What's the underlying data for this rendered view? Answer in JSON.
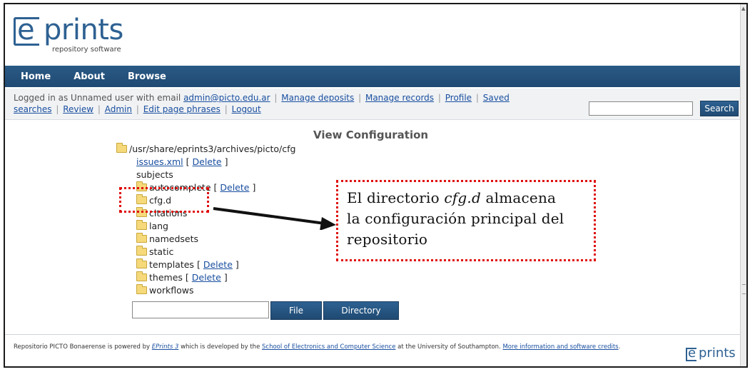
{
  "logo": {
    "e": "e",
    "prints": "prints",
    "subtitle": "repository software"
  },
  "nav": {
    "items": [
      "Home",
      "About",
      "Browse"
    ]
  },
  "login": {
    "prefix": "Logged in as Unnamed user with email ",
    "email": "admin@picto.edu.ar",
    "links_line1": [
      "Manage deposits",
      "Manage records",
      "Profile",
      "Saved"
    ],
    "links_line2": [
      "searches",
      "Review",
      "Admin",
      "Edit page phrases",
      "Logout"
    ],
    "separator": "|"
  },
  "search": {
    "button_label": "Search",
    "value": ""
  },
  "page": {
    "title": "View Configuration"
  },
  "tree": {
    "root": "/usr/share/eprints3/archives/picto/cfg",
    "delete_open": "[",
    "delete_label": "Delete",
    "delete_close": "]",
    "items": [
      {
        "name": "issues.xml",
        "type": "file-link",
        "deletable": true
      },
      {
        "name": "subjects",
        "type": "text",
        "deletable": false
      },
      {
        "name": "autocomplete",
        "type": "folder",
        "deletable": true
      },
      {
        "name": "cfg.d",
        "type": "folder",
        "deletable": false
      },
      {
        "name": "citations",
        "type": "folder",
        "deletable": false
      },
      {
        "name": "lang",
        "type": "folder",
        "deletable": false
      },
      {
        "name": "namedsets",
        "type": "folder",
        "deletable": false
      },
      {
        "name": "static",
        "type": "folder",
        "deletable": false
      },
      {
        "name": "templates",
        "type": "folder",
        "deletable": true
      },
      {
        "name": "themes",
        "type": "folder",
        "deletable": true
      },
      {
        "name": "workflows",
        "type": "folder",
        "deletable": false
      }
    ]
  },
  "upload": {
    "file_label": "File",
    "directory_label": "Directory",
    "value": ""
  },
  "annotation": {
    "line1_prefix": "El directorio ",
    "line1_em": "cfg.d",
    "line1_suffix": " almacena",
    "line2": "la configuración principal del",
    "line3": "repositorio"
  },
  "footer": {
    "t1": "Repositorio PICTO Bonaerense is powered by ",
    "l1": "EPrints 3",
    "t2": " which is developed by the ",
    "l2": "School of Electronics and Computer Science",
    "t3": " at the University of Southampton. ",
    "l3": "More information and software credits",
    "t4": "."
  },
  "colors": {
    "brand": "#2e6192",
    "navbar": "#1f4a72",
    "link": "#1a4fa0",
    "annotation": "#e01010"
  }
}
